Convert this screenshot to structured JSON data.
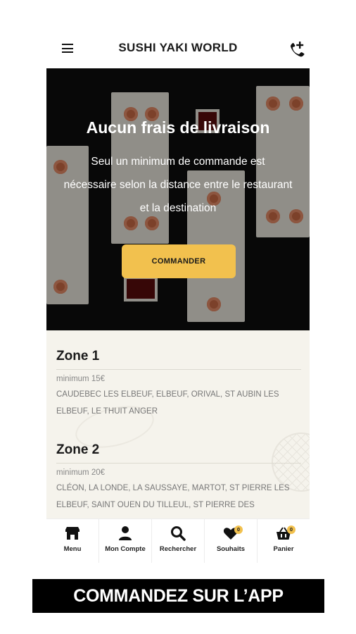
{
  "header": {
    "title": "SUSHI YAKI WORLD",
    "menu_icon": "hamburger-menu-icon",
    "phone_icon": "phone-add-icon"
  },
  "hero": {
    "title": "Aucun frais de livraison",
    "text": "Seul un minimum de commande est nécessaire selon la distance entre le restaurant et la destination",
    "button_label": "COMMANDER"
  },
  "zones": [
    {
      "title": "Zone 1",
      "minimum": "minimum 15€",
      "cities": "CAUDEBEC LES ELBEUF, ELBEUF, ORIVAL, ST AUBIN LES ELBEUF, LE THUIT ANGER"
    },
    {
      "title": "Zone 2",
      "minimum": "minimum 20€",
      "cities": "CLÉON, LA LONDE, LA SAUSSAYE, MARTOT, ST PIERRE LES ELBEUF, SAINT OUEN DU TILLEUL, ST PIERRE DES"
    }
  ],
  "nav": {
    "items": [
      {
        "label": "Menu",
        "icon": "store-icon"
      },
      {
        "label": "Mon Compte",
        "icon": "user-icon"
      },
      {
        "label": "Rechercher",
        "icon": "search-icon"
      },
      {
        "label": "Souhaits",
        "icon": "heart-icon",
        "badge": "0"
      },
      {
        "label": "Panier",
        "icon": "basket-icon",
        "badge": "0"
      }
    ]
  },
  "banner": {
    "label": "COMMANDEZ SUR L’APP"
  },
  "colors": {
    "accent": "#f2c14e",
    "background_zones": "#f5f3ec",
    "banner": "#000000"
  }
}
